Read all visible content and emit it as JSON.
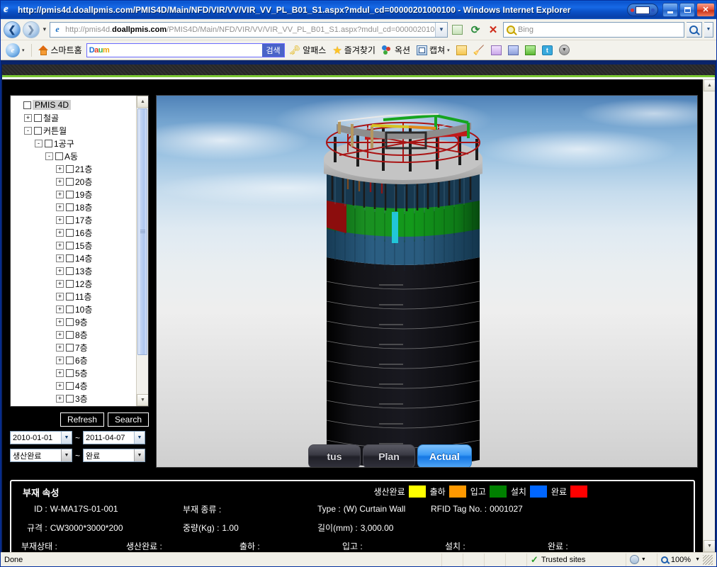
{
  "window": {
    "title": "http://pmis4d.doallpmis.com/PMIS4D/Main/NFD/VIR/VV/VIR_VV_PL_B01_S1.aspx?mdul_cd=00000201000100 - Windows Internet Explorer",
    "minimize_label": "Minimize",
    "maximize_label": "Maximize",
    "close_label": "Close"
  },
  "address_bar": {
    "protocol": "http://pmis4d.",
    "domain": "doallpmis.com",
    "path": "/PMIS4D/Main/NFD/VIR/VV/VIR_VV_PL_B01_S1.aspx?mdul_cd=0000020100",
    "back_label": "Back",
    "forward_label": "Forward",
    "recent_label": "Recent Pages",
    "compat_label": "Compatibility View",
    "refresh_label": "Refresh",
    "stop_label": "Stop",
    "search_placeholder": "Bing",
    "search_go_label": "Search"
  },
  "toolbar": {
    "ie_label": "Internet Explorer",
    "home_label": "스마트홈",
    "daum_logo": [
      "D",
      "a",
      "u",
      "m"
    ],
    "daum_value": "",
    "daum_search_btn": "검색",
    "alpass_label": "알패스",
    "favorites_label": "즐겨찾기",
    "auction_label": "옥션",
    "capture_label": "캡쳐",
    "note_label": "메모",
    "broom_label": "클리너",
    "book_label": "북마크",
    "save_label": "저장",
    "export_label": "내보내기",
    "twitter_label": "트위터",
    "more_label": "더보기"
  },
  "tree": {
    "root_label": "PMIS 4D",
    "nodes": [
      {
        "label": "철골",
        "depth": 1,
        "expander": "+",
        "checked": false
      },
      {
        "label": "커튼월",
        "depth": 1,
        "expander": "-",
        "checked": false
      },
      {
        "label": "1공구",
        "depth": 2,
        "expander": "-",
        "checked": false
      },
      {
        "label": "A동",
        "depth": 3,
        "expander": "-",
        "checked": false
      },
      {
        "label": "21층",
        "depth": 4,
        "expander": "+",
        "checked": false
      },
      {
        "label": "20층",
        "depth": 4,
        "expander": "+",
        "checked": false
      },
      {
        "label": "19층",
        "depth": 4,
        "expander": "+",
        "checked": false
      },
      {
        "label": "18층",
        "depth": 4,
        "expander": "+",
        "checked": false
      },
      {
        "label": "17층",
        "depth": 4,
        "expander": "+",
        "checked": false
      },
      {
        "label": "16층",
        "depth": 4,
        "expander": "+",
        "checked": false
      },
      {
        "label": "15층",
        "depth": 4,
        "expander": "+",
        "checked": false
      },
      {
        "label": "14층",
        "depth": 4,
        "expander": "+",
        "checked": false
      },
      {
        "label": "13층",
        "depth": 4,
        "expander": "+",
        "checked": false
      },
      {
        "label": "12층",
        "depth": 4,
        "expander": "+",
        "checked": false
      },
      {
        "label": "11층",
        "depth": 4,
        "expander": "+",
        "checked": false
      },
      {
        "label": "10층",
        "depth": 4,
        "expander": "+",
        "checked": false
      },
      {
        "label": "9층",
        "depth": 4,
        "expander": "+",
        "checked": false
      },
      {
        "label": "8층",
        "depth": 4,
        "expander": "+",
        "checked": false
      },
      {
        "label": "7층",
        "depth": 4,
        "expander": "+",
        "checked": false
      },
      {
        "label": "6층",
        "depth": 4,
        "expander": "+",
        "checked": false
      },
      {
        "label": "5층",
        "depth": 4,
        "expander": "+",
        "checked": false
      },
      {
        "label": "4층",
        "depth": 4,
        "expander": "+",
        "checked": false
      },
      {
        "label": "3층",
        "depth": 4,
        "expander": "+",
        "checked": false
      }
    ]
  },
  "controls": {
    "refresh_label": "Refresh",
    "search_label": "Search",
    "date_from": "2010-01-01",
    "date_to": "2011-04-07",
    "range_separator": "~",
    "status_from": "생산완료",
    "status_to": "완료"
  },
  "tabs": [
    {
      "label": "tus",
      "active": false
    },
    {
      "label": "Plan",
      "active": false
    },
    {
      "label": "Actual",
      "active": true
    }
  ],
  "properties": {
    "panel_title": "부재 속성",
    "fields": [
      {
        "label": "ID :",
        "value": "W-MA17S-01-001"
      },
      {
        "label": "부재 종류 :",
        "value": ""
      },
      {
        "label": "Type :",
        "value": "(W) Curtain Wall"
      },
      {
        "label": "RFID Tag No. :",
        "value": "0001027"
      },
      {
        "label": "규격 :",
        "value": "CW3000*3000*200"
      },
      {
        "label": "중량(Kg) :",
        "value": "1.00"
      },
      {
        "label": "길이(mm) :",
        "value": "3,000.00"
      },
      {
        "label": "부재상태 :",
        "value": ""
      },
      {
        "label": "생산완료 :",
        "value": ""
      },
      {
        "label": "출하 :",
        "value": ""
      },
      {
        "label": "입고 :",
        "value": ""
      },
      {
        "label": "설치 :",
        "value": ""
      },
      {
        "label": "완료 :",
        "value": ""
      }
    ]
  },
  "legend": [
    {
      "label": "생산완료",
      "color": "#ffff00"
    },
    {
      "label": "출하",
      "color": "#ff9900"
    },
    {
      "label": "입고",
      "color": "#008000"
    },
    {
      "label": "설치",
      "color": "#0066ff"
    },
    {
      "label": "완료",
      "color": "#ff0000"
    }
  ],
  "statusbar": {
    "status": "Done",
    "zone": "Trusted sites",
    "zoom": "100%"
  }
}
